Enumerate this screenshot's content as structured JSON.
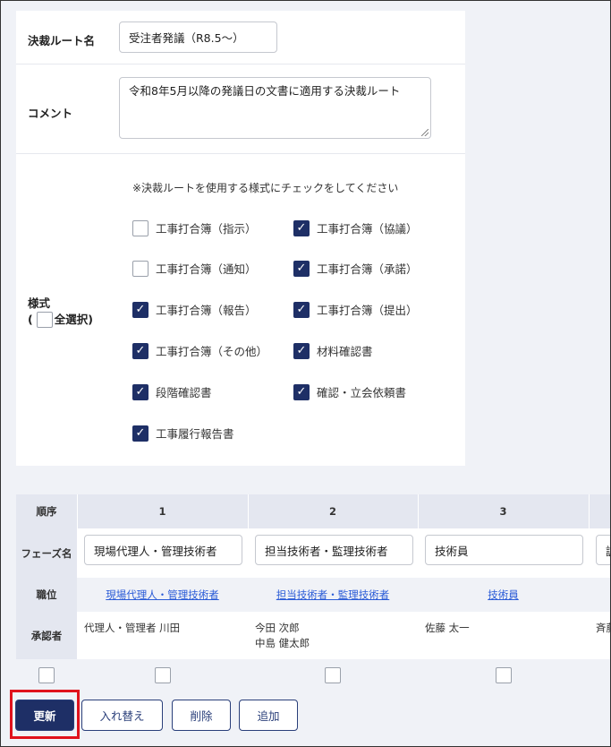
{
  "form": {
    "route_name_label": "決裁ルート名",
    "route_name_value": "受注者発議（R8.5～）",
    "comment_label": "コメント",
    "comment_value": "令和8年5月以降の発議日の文書に適用する決裁ルート",
    "style_label": "様式",
    "style_select_all_open": "(",
    "style_select_all_label": "全選択)",
    "style_note": "※決裁ルートを使用する様式にチェックをしてください",
    "styles": [
      {
        "label": "工事打合簿（指示）",
        "checked": false
      },
      {
        "label": "工事打合簿（協議）",
        "checked": true
      },
      {
        "label": "工事打合簿（通知）",
        "checked": false
      },
      {
        "label": "工事打合簿（承諾）",
        "checked": true
      },
      {
        "label": "工事打合簿（報告）",
        "checked": true
      },
      {
        "label": "工事打合簿（提出）",
        "checked": true
      },
      {
        "label": "工事打合簿（その他）",
        "checked": true
      },
      {
        "label": "材料確認書",
        "checked": true
      },
      {
        "label": "段階確認書",
        "checked": true
      },
      {
        "label": "確認・立会依頼書",
        "checked": true
      },
      {
        "label": "工事履行報告書",
        "checked": true
      }
    ]
  },
  "table": {
    "order_label": "順序",
    "phase_label": "フェーズ名",
    "position_label": "職位",
    "approver_label": "承認者",
    "columns": [
      {
        "order": "1",
        "phase": "現場代理人・管理技術者",
        "position": "現場代理人・管理技術者",
        "approvers": [
          "代理人・管理者 川田"
        ]
      },
      {
        "order": "2",
        "phase": "担当技術者・監理技術者",
        "position": "担当技術者・監理技術者",
        "approvers": [
          "今田 次郎",
          "中島 健太郎"
        ]
      },
      {
        "order": "3",
        "phase": "技術員",
        "position": "技術員",
        "approvers": [
          "佐藤 太一"
        ]
      },
      {
        "order": "",
        "phase": "調",
        "position": "",
        "approvers": [
          "斉藤"
        ]
      }
    ]
  },
  "buttons": {
    "update": "更新",
    "reorder": "入れ替え",
    "delete": "削除",
    "add": "追加"
  },
  "check_mark": "✓"
}
